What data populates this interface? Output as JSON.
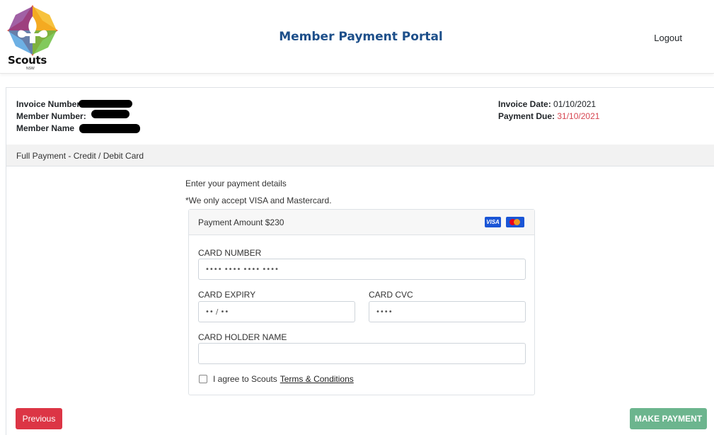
{
  "header": {
    "logo_text": "Scouts",
    "logo_sub": "NSW",
    "title": "Member Payment Portal",
    "logout_label": "Logout"
  },
  "invoice": {
    "invoice_number_label": "Invoice Number",
    "member_number_label": "Member Number:",
    "member_name_label": "Member Name",
    "invoice_date_label": "Invoice Date:",
    "invoice_date_value": "01/10/2021",
    "payment_due_label": "Payment Due:",
    "payment_due_value": "31/10/2021"
  },
  "section_title": "Full Payment - Credit / Debit Card",
  "instructions": {
    "line1": "Enter your payment details",
    "line2": "*We only accept VISA and Mastercard."
  },
  "payment": {
    "amount_label": "Payment Amount $230",
    "card_icons": [
      "visa-icon",
      "mastercard-icon"
    ],
    "visa_text": "VISA"
  },
  "fields": {
    "card_number_label": "CARD NUMBER",
    "card_number_placeholder": "•••• •••• •••• ••••",
    "card_expiry_label": "CARD EXPIRY",
    "card_expiry_placeholder": "•• / ••",
    "card_cvc_label": "CARD CVC",
    "card_cvc_placeholder": "••••",
    "card_holder_label": "CARD HOLDER NAME",
    "card_holder_placeholder": ""
  },
  "agreement": {
    "text": "I agree to Scouts",
    "link": "Terms & Conditions"
  },
  "buttons": {
    "previous": "Previous",
    "make_payment": "MAKE PAYMENT"
  },
  "colors": {
    "title_blue": "#1d4f8a",
    "due_red": "#d64550",
    "previous_red": "#dc3545",
    "pay_green": "#6cb58e"
  }
}
